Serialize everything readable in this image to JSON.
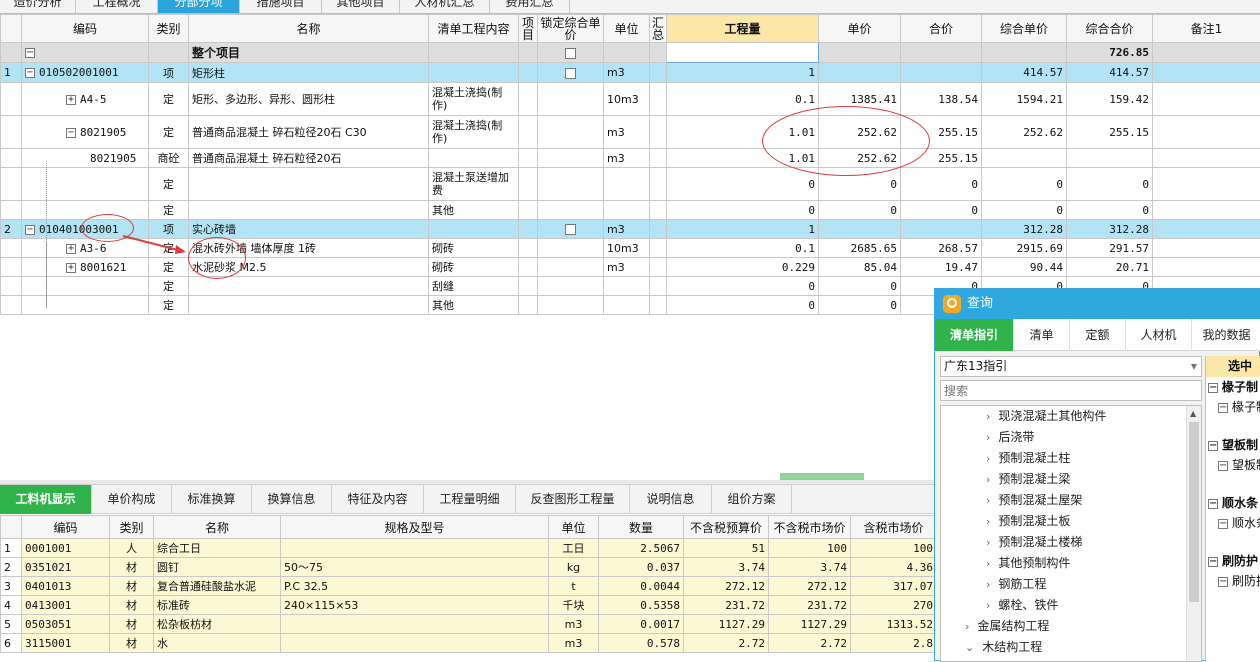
{
  "top_tabs": [
    {
      "label": "造价分析"
    },
    {
      "label": "工程概况"
    },
    {
      "label": "分部分项",
      "active": true
    },
    {
      "label": "措施项目"
    },
    {
      "label": "其他项目"
    },
    {
      "label": "人材机汇总"
    },
    {
      "label": "费用汇总"
    }
  ],
  "main_grid": {
    "headers": [
      "",
      "编码",
      "类别",
      "名称",
      "清单工程内容",
      "项目",
      "锁定综合单价",
      "单位",
      "汇总",
      "工程量",
      "单价",
      "合价",
      "综合单价",
      "综合合价",
      "备注1"
    ],
    "total_row": {
      "name": "整个项目",
      "total": "726.85"
    },
    "rows": [
      {
        "idx": "1",
        "code": "010502001001",
        "cat": "项",
        "name": "矩形柱",
        "content": "",
        "unit": "m3",
        "qty": "1",
        "price": "",
        "sum": "",
        "uprice": "414.57",
        "utotal": "414.57"
      },
      {
        "idx": "",
        "code": "A4-5",
        "cat": "定",
        "name": "矩形、多边形、异形、圆形柱",
        "content": "混凝土浇捣(制作)",
        "unit": "10m3",
        "qty": "0.1",
        "price": "1385.41",
        "sum": "138.54",
        "uprice": "1594.21",
        "utotal": "159.42"
      },
      {
        "idx": "",
        "code": "8021905",
        "cat": "定",
        "name": "普通商品混凝土 碎石粒径20石 C30",
        "content": "混凝土浇捣(制作)",
        "unit": "m3",
        "qty": "1.01",
        "price": "252.62",
        "sum": "255.15",
        "uprice": "252.62",
        "utotal": "255.15"
      },
      {
        "idx": "",
        "code": "8021905",
        "cat": "商砼",
        "name": "普通商品混凝土 碎石粒径20石",
        "content": "",
        "unit": "m3",
        "qty": "1.01",
        "price": "252.62",
        "sum": "255.15",
        "uprice": "",
        "utotal": ""
      },
      {
        "idx": "",
        "code": "",
        "cat": "定",
        "name": "",
        "content": "混凝土泵送增加费",
        "unit": "",
        "qty": "0",
        "price": "0",
        "sum": "0",
        "uprice": "0",
        "utotal": "0"
      },
      {
        "idx": "",
        "code": "",
        "cat": "定",
        "name": "",
        "content": "其他",
        "unit": "",
        "qty": "0",
        "price": "0",
        "sum": "0",
        "uprice": "0",
        "utotal": "0"
      },
      {
        "idx": "2",
        "code": "010401003001",
        "cat": "项",
        "name": "实心砖墙",
        "content": "",
        "unit": "m3",
        "qty": "1",
        "price": "",
        "sum": "",
        "uprice": "312.28",
        "utotal": "312.28"
      },
      {
        "idx": "",
        "code": "A3-6",
        "cat": "定",
        "name": "混水砖外墙 墙体厚度 1砖",
        "content": "砌砖",
        "unit": "10m3",
        "qty": "0.1",
        "price": "2685.65",
        "sum": "268.57",
        "uprice": "2915.69",
        "utotal": "291.57"
      },
      {
        "idx": "",
        "code": "8001621",
        "cat": "定",
        "name": "水泥砂浆 M2.5",
        "content": "砌砖",
        "unit": "m3",
        "qty": "0.229",
        "price": "85.04",
        "sum": "19.47",
        "uprice": "90.44",
        "utotal": "20.71"
      },
      {
        "idx": "",
        "code": "",
        "cat": "定",
        "name": "",
        "content": "刮缝",
        "unit": "",
        "qty": "0",
        "price": "0",
        "sum": "0",
        "uprice": "0",
        "utotal": "0"
      },
      {
        "idx": "",
        "code": "",
        "cat": "定",
        "name": "",
        "content": "其他",
        "unit": "",
        "qty": "0",
        "price": "0",
        "sum": "0",
        "uprice": "0",
        "utotal": "0"
      }
    ]
  },
  "bottom_tabs": [
    {
      "label": "工料机显示",
      "active": true
    },
    {
      "label": "单价构成"
    },
    {
      "label": "标准换算"
    },
    {
      "label": "换算信息"
    },
    {
      "label": "特征及内容"
    },
    {
      "label": "工程量明细"
    },
    {
      "label": "反查图形工程量"
    },
    {
      "label": "说明信息"
    },
    {
      "label": "组价方案"
    }
  ],
  "bottom_grid": {
    "headers": [
      "",
      "编码",
      "类别",
      "名称",
      "规格及型号",
      "单位",
      "数量",
      "不含税预算价",
      "不含税市场价",
      "含税市场价"
    ],
    "rows": [
      {
        "idx": "1",
        "code": "0001001",
        "cat": "人",
        "name": "综合工日",
        "spec": "",
        "unit": "工日",
        "qty": "2.5067",
        "p1": "51",
        "p2": "100",
        "p3": "100"
      },
      {
        "idx": "2",
        "code": "0351021",
        "cat": "材",
        "name": "圆钉",
        "spec": "50～75",
        "unit": "kg",
        "qty": "0.037",
        "p1": "3.74",
        "p2": "3.74",
        "p3": "4.36"
      },
      {
        "idx": "3",
        "code": "0401013",
        "cat": "材",
        "name": "复合普通硅酸盐水泥",
        "spec": "P.C 32.5",
        "unit": "t",
        "qty": "0.0044",
        "p1": "272.12",
        "p2": "272.12",
        "p3": "317.07"
      },
      {
        "idx": "4",
        "code": "0413001",
        "cat": "材",
        "name": "标准砖",
        "spec": "240×115×53",
        "unit": "千块",
        "qty": "0.5358",
        "p1": "231.72",
        "p2": "231.72",
        "p3": "270"
      },
      {
        "idx": "5",
        "code": "0503051",
        "cat": "材",
        "name": "松杂板枋材",
        "spec": "",
        "unit": "m3",
        "qty": "0.0017",
        "p1": "1127.29",
        "p2": "1127.29",
        "p3": "1313.52"
      },
      {
        "idx": "6",
        "code": "3115001",
        "cat": "材",
        "name": "水",
        "spec": "",
        "unit": "m3",
        "qty": "0.578",
        "p1": "2.72",
        "p2": "2.72",
        "p3": "2.8"
      }
    ]
  },
  "query_panel": {
    "title": "查询",
    "tabs": [
      {
        "label": "清单指引",
        "active": true
      },
      {
        "label": "清单"
      },
      {
        "label": "定额"
      },
      {
        "label": "人材机"
      },
      {
        "label": "我的数据"
      }
    ],
    "dropdown_value": "广东13指引",
    "search_placeholder": "搜索",
    "tree_items": [
      "现浇混凝土其他构件",
      "后浇带",
      "预制混凝土柱",
      "预制混凝土梁",
      "预制混凝土屋架",
      "预制混凝土板",
      "预制混凝土楼梯",
      "其他预制构件",
      "钢筋工程",
      "螺栓、铁件",
      "金属结构工程",
      "木结构工程"
    ],
    "right_header": "选中",
    "right_items": [
      "椽子制",
      "椽子制",
      "望板制",
      "望板制",
      "顺水条",
      "顺水条",
      "刷防护",
      "刷防护"
    ]
  },
  "colors": {
    "accent_blue": "#2ea8df",
    "active_green": "#2fb34a",
    "row_highlight": "#b2e4f5",
    "annotation_red": "#e03a3a"
  }
}
